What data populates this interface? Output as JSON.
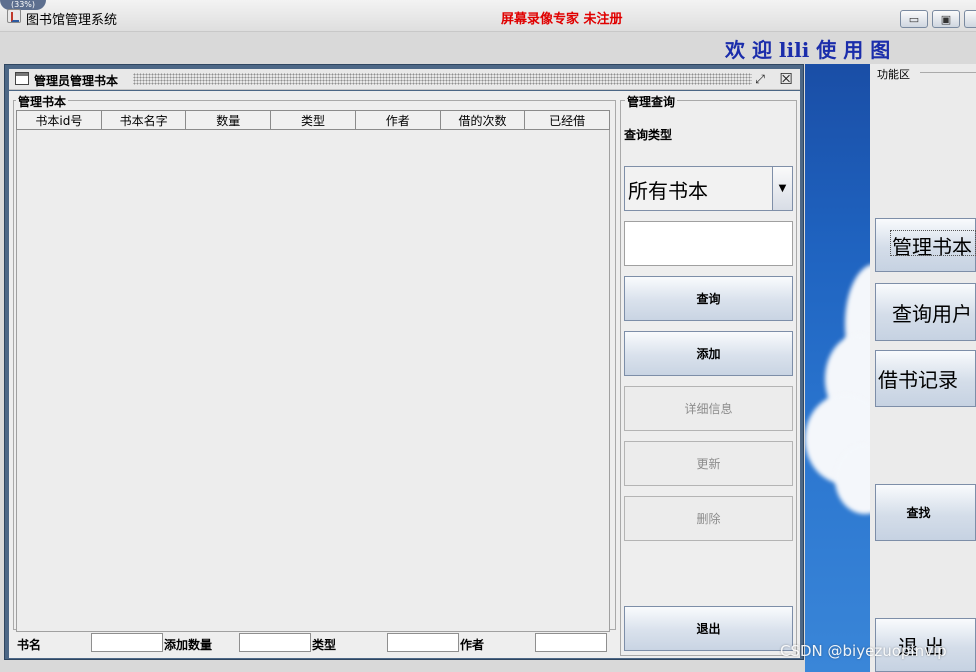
{
  "window": {
    "title": "图书馆管理系统",
    "recorder_banner": "屏幕录像专家  未注册",
    "corner_badge": "(33%)",
    "controls": {
      "minimize": "▭",
      "maximize": "▣",
      "close": "✕"
    }
  },
  "welcome_text": "欢 迎 lili 使 用 图",
  "function_panel": {
    "title": "功能区",
    "buttons": [
      "管理书本",
      "查询用户",
      "借书记录",
      "查找",
      "退 出"
    ]
  },
  "internal_frame": {
    "title": "管理员管理书本",
    "restore_icon": "⤢",
    "close_icon": "☒",
    "books_group_title": "管理书本",
    "table": {
      "columns": [
        "书本id号",
        "书本名字",
        "数量",
        "类型",
        "作者",
        "借的次数",
        "已经借"
      ],
      "rows": []
    },
    "query_group": {
      "title": "管理查询",
      "query_type_label": "查询类型",
      "combo_value": "所有书本",
      "search_value": "",
      "buttons": {
        "query": "查询",
        "add": "添加",
        "details": "详细信息",
        "update": "更新",
        "delete": "删除",
        "exit": "退出"
      }
    },
    "form": {
      "book_name_label": "书名",
      "add_count_label": "添加数量",
      "type_label": "类型",
      "author_label": "作者",
      "book_name_value": "",
      "add_count_value": "",
      "type_value": "",
      "author_value": ""
    }
  },
  "watermark": "CSDN @biyezuopinvip"
}
